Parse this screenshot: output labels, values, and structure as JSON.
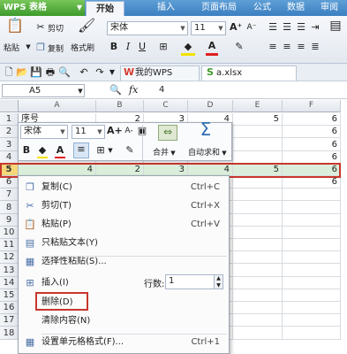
{
  "app": {
    "title": "WPS 表格"
  },
  "ribbon_tabs": [
    "开始",
    "插入",
    "页面布局",
    "公式",
    "数据",
    "审阅"
  ],
  "ribbon": {
    "paste": "粘贴",
    "cut": "剪切",
    "copy": "复制",
    "format_painter": "格式刷",
    "font_name": "宋体",
    "font_size": "11",
    "bold": "B",
    "italic": "I",
    "underline": "U",
    "font_color": "A"
  },
  "doc_tabs": [
    "我的WPS",
    "a.xlsx"
  ],
  "formula_bar": {
    "cell_ref": "A5",
    "fx": "fx",
    "value": "4"
  },
  "columns": [
    "A",
    "B",
    "C",
    "D",
    "E",
    "F"
  ],
  "rows": [
    {
      "num": "1",
      "cells": [
        "序号",
        "2",
        "3",
        "4",
        "5",
        "6"
      ]
    },
    {
      "num": "2",
      "cells": [
        "",
        "",
        "",
        "",
        "",
        "6"
      ]
    },
    {
      "num": "3",
      "cells": [
        "",
        "",
        "",
        "",
        "",
        "6"
      ]
    },
    {
      "num": "4",
      "cells": [
        "",
        "",
        "",
        "",
        "",
        "6"
      ]
    },
    {
      "num": "5",
      "cells": [
        "4",
        "2",
        "3",
        "4",
        "5",
        "6"
      ]
    },
    {
      "num": "6",
      "cells": [
        "",
        "",
        "",
        "",
        "",
        "6"
      ]
    },
    {
      "num": "7",
      "cells": [
        "",
        "",
        "",
        "",
        "",
        ""
      ]
    },
    {
      "num": "8",
      "cells": [
        "",
        "",
        "",
        "",
        "",
        ""
      ]
    },
    {
      "num": "9",
      "cells": [
        "",
        "",
        "",
        "",
        "",
        ""
      ]
    },
    {
      "num": "10",
      "cells": [
        "",
        "",
        "",
        "",
        "",
        ""
      ]
    },
    {
      "num": "11",
      "cells": [
        "",
        "",
        "",
        "",
        "",
        ""
      ]
    },
    {
      "num": "12",
      "cells": [
        "",
        "",
        "",
        "",
        "",
        ""
      ]
    },
    {
      "num": "13",
      "cells": [
        "",
        "",
        "",
        "",
        "",
        ""
      ]
    },
    {
      "num": "14",
      "cells": [
        "",
        "",
        "",
        "",
        "",
        ""
      ]
    },
    {
      "num": "15",
      "cells": [
        "",
        "",
        "",
        "",
        "",
        ""
      ]
    },
    {
      "num": "16",
      "cells": [
        "",
        "",
        "",
        "",
        "",
        ""
      ]
    },
    {
      "num": "17",
      "cells": [
        "",
        "",
        "",
        "",
        "",
        ""
      ]
    },
    {
      "num": "18",
      "cells": [
        "",
        "",
        "",
        "",
        "",
        ""
      ]
    }
  ],
  "mini_toolbar": {
    "font_name": "宋体",
    "font_size": "11",
    "grow": "A+",
    "shrink": "A-",
    "bold": "B",
    "font_color": "A",
    "merge": "合并",
    "autosum": "自动求和"
  },
  "context_menu": {
    "items": [
      {
        "label": "复制(C)",
        "shortcut": "Ctrl+C",
        "icon": "copy-icon",
        "glyph": "❐"
      },
      {
        "label": "剪切(T)",
        "shortcut": "Ctrl+X",
        "icon": "scissors-icon",
        "glyph": "✂"
      },
      {
        "label": "粘贴(P)",
        "shortcut": "Ctrl+V",
        "icon": "paste-icon",
        "glyph": "📋"
      },
      {
        "label": "只粘贴文本(Y)",
        "shortcut": "",
        "icon": "paste-text-icon",
        "glyph": "▤"
      },
      {
        "label": "选择性粘贴(S)...",
        "shortcut": "",
        "icon": "paste-special-icon",
        "glyph": "▦"
      },
      {
        "label": "插入(I)",
        "shortcut": "",
        "icon": "insert-rows-icon",
        "glyph": "⊞"
      },
      {
        "label": "删除(D)",
        "shortcut": "",
        "icon": "",
        "glyph": ""
      },
      {
        "label": "清除内容(N)",
        "shortcut": "",
        "icon": "",
        "glyph": ""
      },
      {
        "label": "设置单元格格式(F)...",
        "shortcut": "Ctrl+1",
        "icon": "format-cells-icon",
        "glyph": "▦"
      }
    ],
    "row_count_label": "行数:",
    "row_count_value": "1"
  },
  "colors": {
    "highlight_red": "#c8372d",
    "selected_row": "#dbeedb",
    "ribbon_blue": "#3c7fc1",
    "app_green": "#4aa733"
  }
}
